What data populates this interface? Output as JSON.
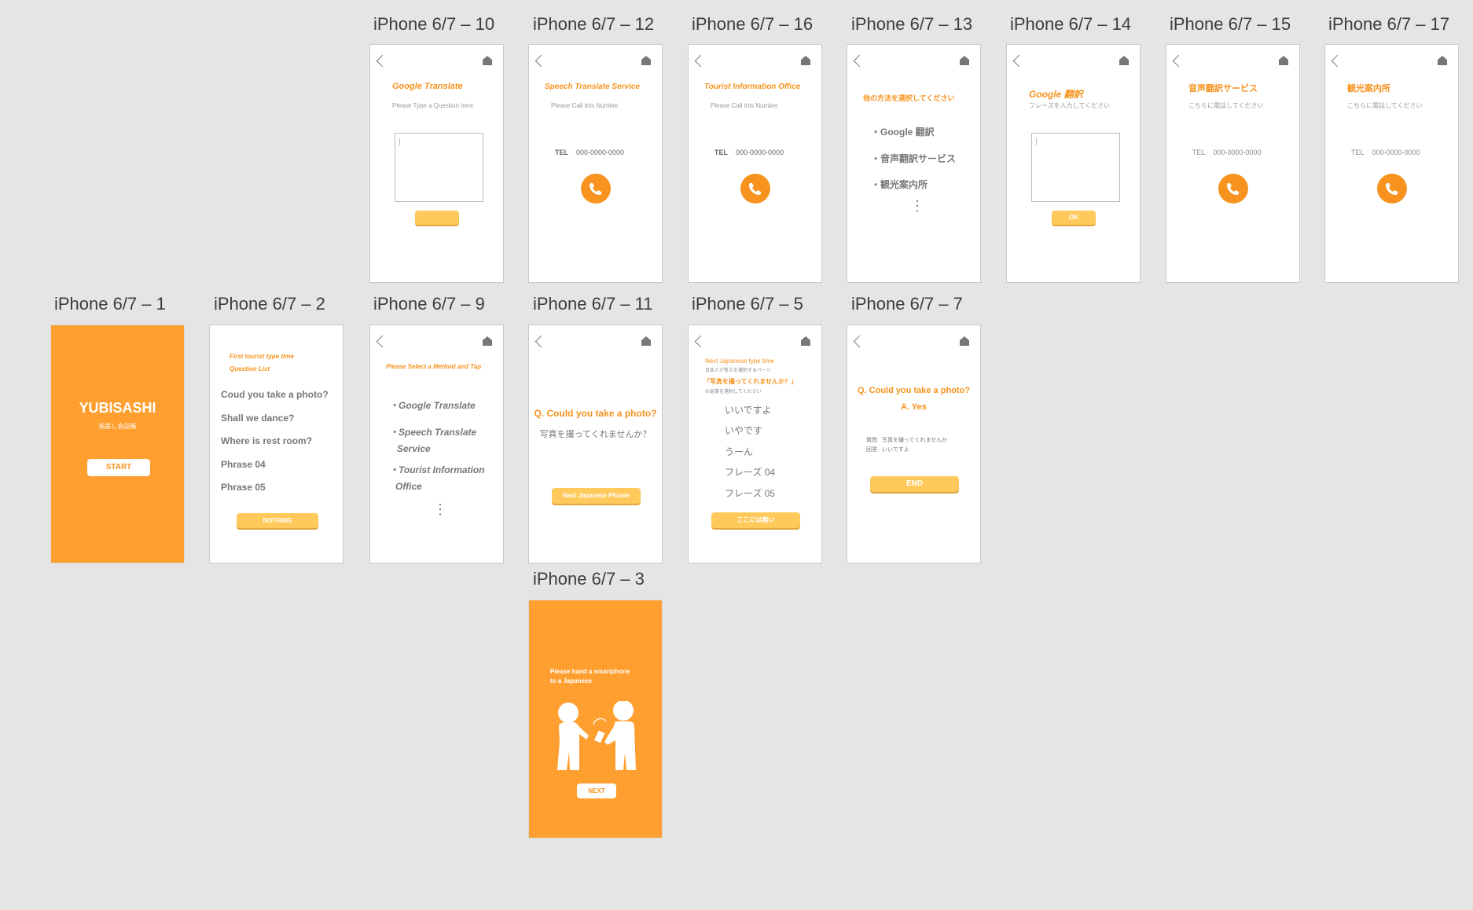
{
  "labels": {
    "a10": "iPhone 6/7 – 10",
    "a12": "iPhone 6/7 – 12",
    "a16": "iPhone 6/7 – 16",
    "a13": "iPhone 6/7 – 13",
    "a14": "iPhone 6/7 – 14",
    "a15": "iPhone 6/7 – 15",
    "a17": "iPhone 6/7 – 17",
    "a1": "iPhone 6/7 – 1",
    "a2": "iPhone 6/7 – 2",
    "a9": "iPhone 6/7 – 9",
    "a11": "iPhone 6/7 – 11",
    "a5": "iPhone 6/7 – 5",
    "a7": "iPhone 6/7 – 7",
    "a3": "iPhone 6/7 – 3"
  },
  "s10": {
    "title": "Google Translate",
    "hint": "Please Type a Question here",
    "button": ""
  },
  "s12": {
    "title": "Speech Translate Service",
    "hint": "Please Call this Number",
    "tel_label": "TEL",
    "tel": "000-0000-0000"
  },
  "s16": {
    "title": "Tourist Information Office",
    "hint": "Please Call this Number",
    "tel_label": "TEL",
    "tel": "000-0000-0000"
  },
  "s13": {
    "title": "他の方法を選択してください",
    "items": [
      "・Google 翻訳",
      "・音声翻訳サービス",
      "・観光案内所"
    ],
    "more": "⋮"
  },
  "s14": {
    "title": "Google 翻訳",
    "hint": "フレーズを入力してください",
    "button": "OK"
  },
  "s15": {
    "title": "音声翻訳サービス",
    "hint": "こちらに電話してください",
    "tel_label": "TEL",
    "tel": "000-0000-0000"
  },
  "s17": {
    "title": "観光案内所",
    "hint": "こちらに電話してください",
    "tel_label": "TEL",
    "tel": "000-0000-0000"
  },
  "s1": {
    "title": "YUBISASHI",
    "subtitle": "指差し会話帳",
    "button": "START"
  },
  "s2": {
    "head1": "First tourist type time",
    "head2": "Question List",
    "items": [
      "Coud you take a photo?",
      "Shall we dance?",
      "Where is rest room?",
      "Phrase  04",
      "Phrase  05"
    ],
    "button": "NOTHING"
  },
  "s9": {
    "title": "Please Select a Method and Tap",
    "items": [
      "・Google Translate",
      "・Speech Translate",
      "Service",
      "・Tourist Information",
      "Office"
    ],
    "more": "⋮"
  },
  "s11": {
    "question": "Q. Could you take a photo?",
    "jp": "写真を撮ってくれませんか？",
    "button": "Next Japanese Phrase"
  },
  "s5": {
    "head1": "Next Japanese type time",
    "head2": "日本人が答えを選択するページ",
    "quote": "「写真を撮ってくれませんか？」",
    "head3": "の返事を選択してください",
    "items": [
      "いいですよ",
      "いやです",
      "うーん",
      "フレーズ 04",
      "フレーズ 05"
    ],
    "button": "ここには無い"
  },
  "s7": {
    "question": "Q. Could you take a photo?",
    "answer": "A. Yes",
    "q_label": "質問",
    "q_text": "写真を撮ってくれませんか",
    "a_label": "回答",
    "a_text": "いいですよ",
    "button": "END"
  },
  "s3": {
    "line1": "Please hand a smartphone",
    "line2": "to a Japanese",
    "button": "NEXT"
  }
}
